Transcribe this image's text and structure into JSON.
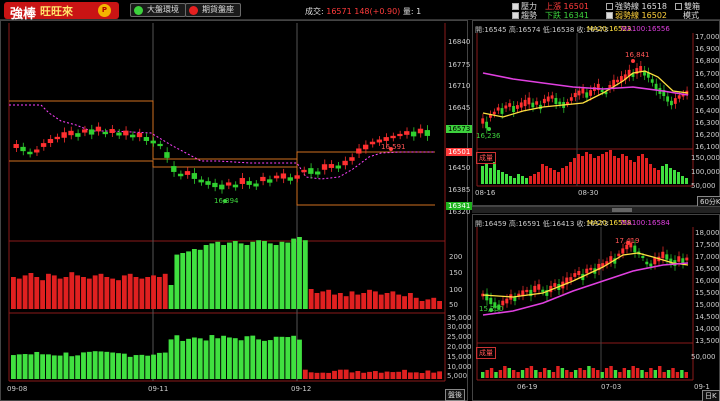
{
  "app": {
    "brand_main": "強棒",
    "brand_sub": "旺旺來",
    "brand_badge": "PLUS"
  },
  "toolbar": {
    "market_label": "大盤環境",
    "futures_label": "期貨盤座"
  },
  "quote": {
    "volume_label": "成交:",
    "price": "16571",
    "change": "148(+0.90)",
    "qty_label": "量:",
    "qty": "1"
  },
  "legend": {
    "pressure_label": "壓力",
    "trend_label": "趨勢",
    "break_up_label": "上漲",
    "break_up_value": "16501",
    "break_down_label": "下跌",
    "break_down_value": "16341",
    "strong_label": "強勢線",
    "strong_value": "16518",
    "weak_label": "弱勢線",
    "weak_value": "16502",
    "dual_label": "雙箱",
    "mode_label": "模式"
  },
  "left_chart": {
    "price_ticks": [
      "16840",
      "16775",
      "16710",
      "16645",
      "16580",
      "16515",
      "16450",
      "16385",
      "16320"
    ],
    "vol_ticks": [
      "250",
      "200",
      "150",
      "100",
      "50",
      "0"
    ],
    "ind_ticks": [
      "35,000",
      "30,000",
      "25,000",
      "20,000",
      "15,000",
      "10,000",
      "5,000",
      "0"
    ],
    "dates": [
      "09-08",
      "09-11",
      "09-12"
    ],
    "tag_last": "16573",
    "tag_mid": "16501",
    "tag_low": "16341",
    "high_label": "16,591",
    "low_label": "16,394",
    "bottom_button": "盤後",
    "chart_data": {
      "type": "candlestick",
      "ylim": [
        16320,
        16840
      ],
      "overlays": {
        "upper_box": 16680,
        "lower_box": 16330
      }
    }
  },
  "right_top": {
    "header": "開:16545 高:16574 低:16538 收:16573",
    "ma20": "MA20:16523",
    "ma100": "MA100:16556",
    "price_ticks": [
      "17,000",
      "16,900",
      "16,800",
      "16,700",
      "16,600",
      "16,500",
      "16,400",
      "16,300",
      "16,200",
      "16,100"
    ],
    "vol_ticks": [
      "150,000",
      "100,000",
      "50,000"
    ],
    "dates": [
      "08-16",
      "08-30"
    ],
    "high_label": "16,841",
    "low_label": "16,236",
    "period_button": "60分K",
    "vol_tag": "成量"
  },
  "right_bottom": {
    "header": "開:16459 高:16591 低:16413 收:16573",
    "ma20": "MA20:16558",
    "ma100": "MA100:16584",
    "price_ticks": [
      "18,000",
      "17,500",
      "17,000",
      "16,500",
      "16,000",
      "15,500",
      "15,000",
      "14,500",
      "14,000",
      "13,500"
    ],
    "vol_ticks": [
      "50,000"
    ],
    "dates": [
      "06-19",
      "07-03",
      "09-1"
    ],
    "high_label": "17,419",
    "low_label": "15,250",
    "period_button": "日K",
    "vol_tag": "成量"
  }
}
